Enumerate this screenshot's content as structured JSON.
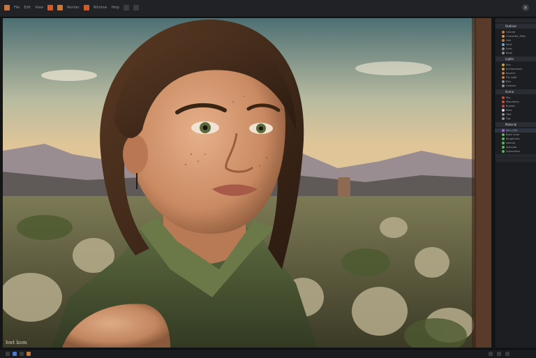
{
  "app": {
    "menu": [
      "File",
      "Edit",
      "View",
      "Render",
      "Window",
      "Help"
    ],
    "toolbar_icons": [
      "app-logo-icon",
      "open-icon",
      "save-icon",
      "undo-icon",
      "redo-icon",
      "render-icon"
    ],
    "close_glyph": "×"
  },
  "viewport": {
    "watermark": "hwt kom"
  },
  "panel": {
    "sections": [
      {
        "header": "Outliner",
        "rows": [
          {
            "label": "Ground",
            "color": "#c8783a"
          },
          {
            "label": "Character_Main",
            "color": "#d39a3c"
          },
          {
            "label": "Hair",
            "color": "#c8783a"
          },
          {
            "label": "Shirt",
            "color": "#6fa8d6"
          },
          {
            "label": "Eyes",
            "color": "#8a8d92"
          },
          {
            "label": "Body",
            "color": "#8a8d92"
          }
        ]
      },
      {
        "header": "Lights",
        "rows": [
          {
            "label": "Sun",
            "color": "#d39a3c"
          },
          {
            "label": "Environment",
            "color": "#d39a3c"
          },
          {
            "label": "Bounce",
            "color": "#c8783a"
          },
          {
            "label": "Fill_Light",
            "color": "#c8783a"
          },
          {
            "label": "Rim",
            "color": "#8a8d92"
          },
          {
            "label": "Camera",
            "color": "#8a8d92"
          }
        ]
      },
      {
        "header": "Scene",
        "rows": [
          {
            "label": "Sky",
            "color": "#c84a3a"
          },
          {
            "label": "Mountains",
            "color": "#c84a3a"
          },
          {
            "label": "Bushes",
            "color": "#c84a3a"
          },
          {
            "label": "Rock",
            "color": "#d8d8d8"
          },
          {
            "label": "Tree",
            "color": "#8a8d92"
          },
          {
            "label": "Fog",
            "color": "#8a8d92"
          }
        ]
      },
      {
        "header": "Material",
        "rows": [
          {
            "label": "Skin_SSS",
            "color": "#b05ad0",
            "selected": true
          },
          {
            "label": "Base Color",
            "color": "#5fb35a"
          },
          {
            "label": "Roughness",
            "color": "#5fb35a"
          },
          {
            "label": "Normal",
            "color": "#5fb35a"
          },
          {
            "label": "Specular",
            "color": "#5fb35a"
          },
          {
            "label": "Subsurface",
            "color": "#5fb35a"
          }
        ]
      }
    ]
  }
}
